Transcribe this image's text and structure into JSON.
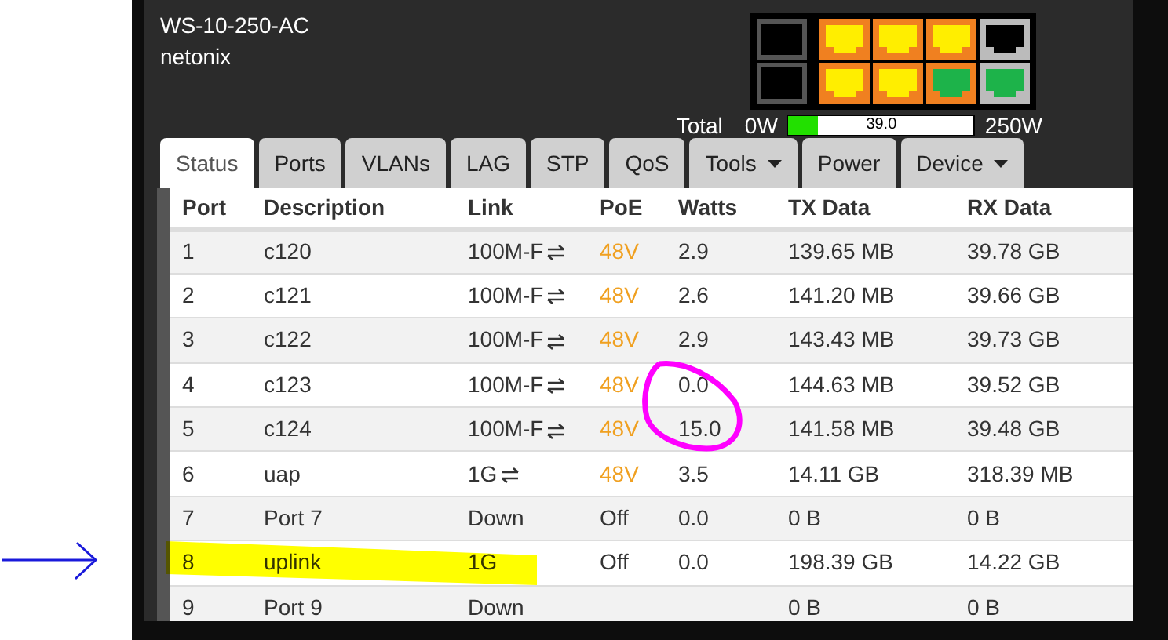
{
  "device": {
    "model": "WS-10-250-AC",
    "brand": "netonix"
  },
  "ports_diagram": [
    {
      "kind": "rj45",
      "poe": true,
      "color": "#ffee00"
    },
    {
      "kind": "rj45",
      "poe": true,
      "color": "#ffee00"
    },
    {
      "kind": "rj45",
      "poe": true,
      "color": "#ffee00"
    },
    {
      "kind": "rj45",
      "poe": true,
      "color": "#ffee00"
    },
    {
      "kind": "rj45",
      "poe": true,
      "color": "#ffee00"
    },
    {
      "kind": "rj45",
      "poe": true,
      "color": "#1db34a"
    },
    {
      "kind": "rj45",
      "poe": false,
      "color": "#000000"
    },
    {
      "kind": "rj45",
      "poe": false,
      "color": "#1db34a"
    },
    {
      "kind": "sfp",
      "color": "#000000"
    },
    {
      "kind": "sfp",
      "color": "#000000"
    }
  ],
  "power": {
    "label": "Total",
    "min": "0W",
    "max": "250W",
    "reading": "39.0",
    "level": 0.156
  },
  "tabs": [
    {
      "label": "Status",
      "selected": true,
      "dropdown": false
    },
    {
      "label": "Ports",
      "selected": false,
      "dropdown": false
    },
    {
      "label": "VLANs",
      "selected": false,
      "dropdown": false
    },
    {
      "label": "LAG",
      "selected": false,
      "dropdown": false
    },
    {
      "label": "STP",
      "selected": false,
      "dropdown": false
    },
    {
      "label": "QoS",
      "selected": false,
      "dropdown": false
    },
    {
      "label": "Tools",
      "selected": false,
      "dropdown": true
    },
    {
      "label": "Power",
      "selected": false,
      "dropdown": false
    },
    {
      "label": "Device",
      "selected": false,
      "dropdown": true
    }
  ],
  "table": {
    "columns": [
      "Port",
      "Description",
      "Link",
      "PoE",
      "Watts",
      "TX Data",
      "RX Data"
    ],
    "rows": [
      {
        "port": "1",
        "description": "c120",
        "link": "100M-F",
        "flow": true,
        "poe": "48V",
        "poe_on": true,
        "watts": "2.9",
        "tx": "139.65 MB",
        "rx": "39.78 GB"
      },
      {
        "port": "2",
        "description": "c121",
        "link": "100M-F",
        "flow": true,
        "poe": "48V",
        "poe_on": true,
        "watts": "2.6",
        "tx": "141.20 MB",
        "rx": "39.66 GB"
      },
      {
        "port": "3",
        "description": "c122",
        "link": "100M-F",
        "flow": true,
        "poe": "48V",
        "poe_on": true,
        "watts": "2.9",
        "tx": "143.43 MB",
        "rx": "39.73 GB"
      },
      {
        "port": "4",
        "description": "c123",
        "link": "100M-F",
        "flow": true,
        "poe": "48V",
        "poe_on": true,
        "watts": "0.0",
        "tx": "144.63 MB",
        "rx": "39.52 GB"
      },
      {
        "port": "5",
        "description": "c124",
        "link": "100M-F",
        "flow": true,
        "poe": "48V",
        "poe_on": true,
        "watts": "15.0",
        "tx": "141.58 MB",
        "rx": "39.48 GB"
      },
      {
        "port": "6",
        "description": "uap",
        "link": "1G",
        "flow": true,
        "poe": "48V",
        "poe_on": true,
        "watts": "3.5",
        "tx": "14.11 GB",
        "rx": "318.39 MB"
      },
      {
        "port": "7",
        "description": "Port 7",
        "link": "Down",
        "flow": false,
        "poe": "Off",
        "poe_on": false,
        "watts": "0.0",
        "tx": "0 B",
        "rx": "0 B"
      },
      {
        "port": "8",
        "description": "uplink",
        "link": "1G",
        "flow": false,
        "poe": "Off",
        "poe_on": false,
        "watts": "0.0",
        "tx": "198.39 GB",
        "rx": "14.22 GB"
      },
      {
        "port": "9",
        "description": "Port 9",
        "link": "Down",
        "flow": false,
        "tx": "0 B",
        "rx": "0 B"
      }
    ]
  },
  "annotations": [
    {
      "kind": "arrow",
      "color": "#1a1adb"
    },
    {
      "kind": "highlight",
      "color": "#ffff00"
    },
    {
      "kind": "circle",
      "color": "#ff00ff"
    }
  ]
}
